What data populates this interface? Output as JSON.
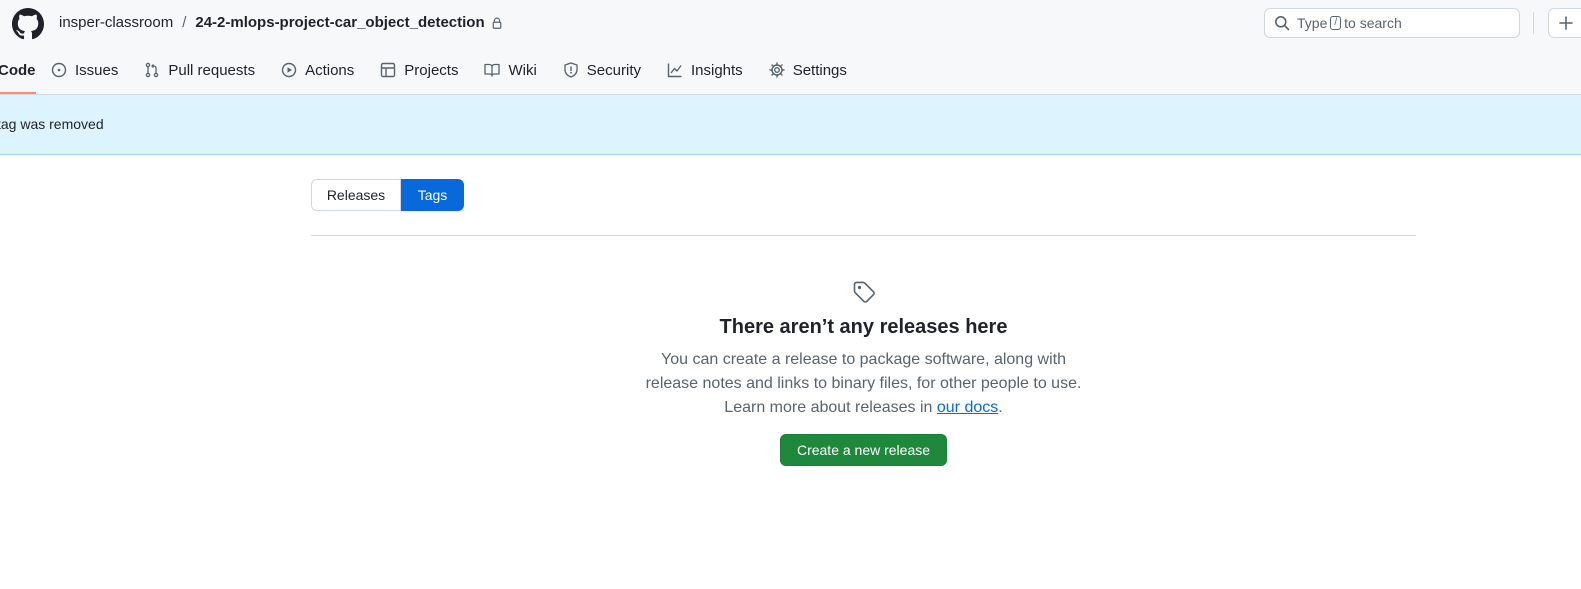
{
  "header": {
    "owner": "insper-classroom",
    "separator": "/",
    "repo": "24-2-mlops-project-car_object_detection",
    "search": {
      "prefix": "Type",
      "key": "/",
      "suffix": "to search"
    }
  },
  "tabs": [
    {
      "label": "Code",
      "icon": "code-icon",
      "active": true
    },
    {
      "label": "Issues",
      "icon": "issue-opened-icon"
    },
    {
      "label": "Pull requests",
      "icon": "git-pull-request-icon"
    },
    {
      "label": "Actions",
      "icon": "play-icon"
    },
    {
      "label": "Projects",
      "icon": "table-icon"
    },
    {
      "label": "Wiki",
      "icon": "book-icon"
    },
    {
      "label": "Security",
      "icon": "shield-icon"
    },
    {
      "label": "Insights",
      "icon": "graph-icon"
    },
    {
      "label": "Settings",
      "icon": "gear-icon"
    }
  ],
  "flash": {
    "message": "tag was removed"
  },
  "toggle": {
    "releases": "Releases",
    "tags": "Tags",
    "selected": "Tags"
  },
  "blankslate": {
    "title": "There aren’t any releases here",
    "line1": "You can create a release to package software, along with",
    "line2": "release notes and links to binary files, for other people to use.",
    "line3_prefix": "Learn more about releases in",
    "link": "our docs",
    "line3_suffix": ".",
    "button": "Create a new release"
  },
  "colors": {
    "accent": "#0969da",
    "primary_button": "#1f883d",
    "flash_bg": "#ddf4ff",
    "active_tab_underline": "#fd8c73"
  }
}
